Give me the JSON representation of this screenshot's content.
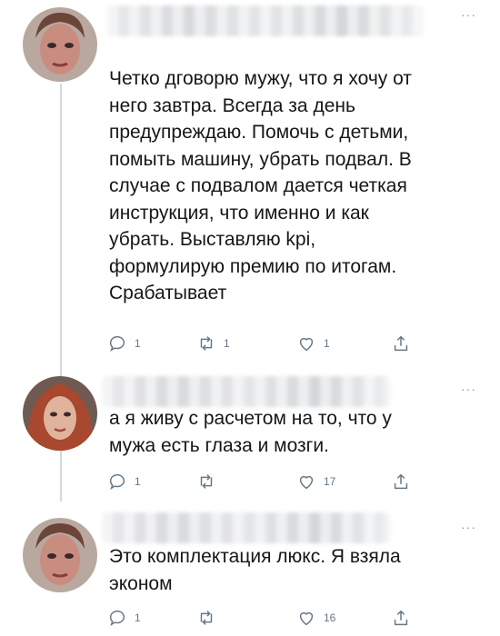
{
  "tweets": [
    {
      "text": "Четко дговорю мужу, что я хочу от\nнего завтра. Всегда за день\nпредупреждаю. Помочь с детьми,\nпомыть машину, убрать подвал. В\nслучае с подвалом дается четкая\nинструкция, что именно и как\nубрать.  Выставляю kpi,\nформулирую премию по итогам.\nСрабатывает",
      "reply_count": "1",
      "retweet_count": "1",
      "like_count": "1"
    },
    {
      "text": "а я живу с расчетом на то, что у\nмужа есть глаза и мозги.",
      "reply_count": "1",
      "retweet_count": "",
      "like_count": "17"
    },
    {
      "text": "Это комплектация люкс. Я взяла\nэконом",
      "reply_count": "1",
      "retweet_count": "",
      "like_count": "16"
    }
  ],
  "more_label": "···",
  "icons": {
    "reply": "reply-icon",
    "retweet": "retweet-icon",
    "like": "heart-icon",
    "share": "share-icon"
  },
  "colors": {
    "text": "#14171a",
    "icon": "#657786",
    "thread_line": "#cfd9de"
  }
}
